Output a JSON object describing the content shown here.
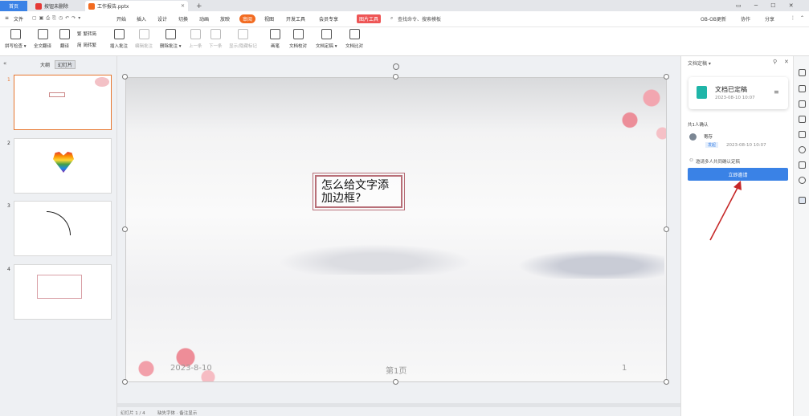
{
  "tabs": {
    "home": "首页",
    "pdf": "按钮未删除",
    "ppt": "工作报告.pptx",
    "add": "+"
  },
  "menu": {
    "file": "文件",
    "items": [
      "开始",
      "插入",
      "设计",
      "切换",
      "动画",
      "放映",
      "审阅",
      "视图",
      "开发工具",
      "会员专享",
      "图片工具"
    ],
    "search": "查找命令、搜索模板",
    "right": [
      "OB-OB更新",
      "协作",
      "分享"
    ]
  },
  "toolbar": {
    "items": [
      {
        "label": "拼写检查 ▾",
        "enabled": true
      },
      {
        "label": "全文翻译",
        "enabled": true
      },
      {
        "label": "翻译",
        "enabled": true
      },
      {
        "label": "繁转简",
        "enabled": true
      },
      {
        "label": "简转繁",
        "enabled": true
      },
      {
        "label": "插入批注",
        "enabled": true
      },
      {
        "label": "编辑批注",
        "enabled": false
      },
      {
        "label": "删除批注 ▾",
        "enabled": true
      },
      {
        "label": "上一条",
        "enabled": false
      },
      {
        "label": "下一条",
        "enabled": false
      },
      {
        "label": "显示/隐藏标记",
        "enabled": false
      },
      {
        "label": "画笔",
        "enabled": true
      },
      {
        "label": "文档校对",
        "enabled": true
      },
      {
        "label": "文档定稿 ▾",
        "enabled": true
      },
      {
        "label": "文档比对",
        "enabled": true
      }
    ]
  },
  "left_panel": {
    "tab_outline": "大纲",
    "tab_slides": "幻灯片",
    "slides": [
      "1",
      "2",
      "3",
      "4"
    ]
  },
  "slide": {
    "textbox": "怎么给文字添加边框?",
    "date": "2023-8-10",
    "page_label": "第1页",
    "page_number": "1"
  },
  "right_panel": {
    "title": "文档定稿 ▾",
    "card_title": "文档已定稿",
    "card_time": "2023-08-10 10:07",
    "count_label": "共1人确认",
    "user_name": "寄存",
    "user_badge": "发起",
    "user_time": "2023-08-10 10:07",
    "notice": "邀请多人共同确认定稿",
    "button": "立即邀请"
  },
  "status": {
    "left": "幻灯片 1 / 4",
    "mid": "缺失字体 · 备注显示"
  },
  "colors": {
    "accent": "#3a82e6",
    "review_tab": "#f26b21",
    "arrow": "#c62828",
    "textbox_border": "#b86f78"
  }
}
